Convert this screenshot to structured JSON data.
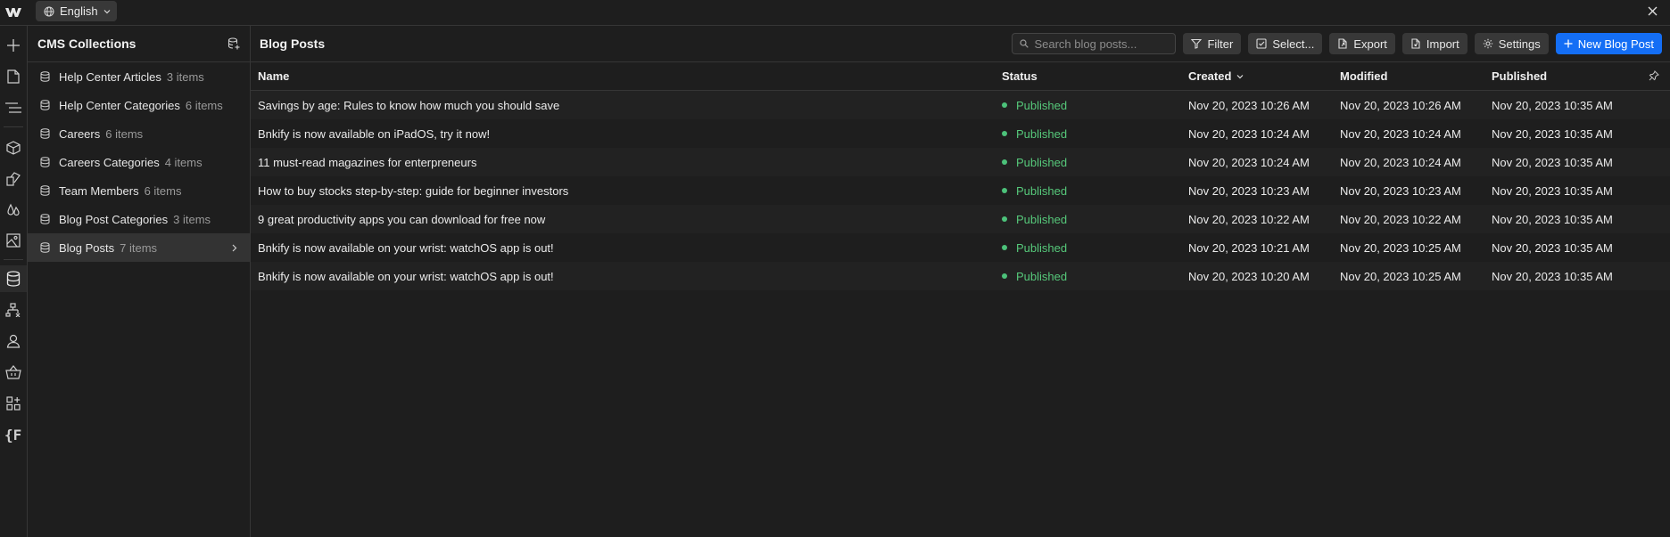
{
  "topbar": {
    "language": "English"
  },
  "collections": {
    "title": "CMS Collections",
    "items": [
      {
        "name": "Help Center Articles",
        "count": "3 items"
      },
      {
        "name": "Help Center Categories",
        "count": "6 items"
      },
      {
        "name": "Careers",
        "count": "6 items"
      },
      {
        "name": "Careers Categories",
        "count": "4 items"
      },
      {
        "name": "Team Members",
        "count": "6 items"
      },
      {
        "name": "Blog Post Categories",
        "count": "3 items"
      },
      {
        "name": "Blog Posts",
        "count": "7 items"
      }
    ]
  },
  "main": {
    "title": "Blog Posts",
    "search_placeholder": "Search blog posts...",
    "buttons": {
      "filter": "Filter",
      "select": "Select...",
      "export": "Export",
      "import": "Import",
      "settings": "Settings",
      "new": "New Blog Post"
    },
    "columns": {
      "name": "Name",
      "status": "Status",
      "created": "Created",
      "modified": "Modified",
      "published": "Published"
    },
    "rows": [
      {
        "name": "Savings by age: Rules to know how much you should save",
        "status": "Published",
        "created": "Nov 20, 2023 10:26 AM",
        "modified": "Nov 20, 2023 10:26 AM",
        "published": "Nov 20, 2023 10:35 AM"
      },
      {
        "name": "Bnkify is now available on iPadOS, try it now!",
        "status": "Published",
        "created": "Nov 20, 2023 10:24 AM",
        "modified": "Nov 20, 2023 10:24 AM",
        "published": "Nov 20, 2023 10:35 AM"
      },
      {
        "name": "11 must-read magazines for enterpreneurs",
        "status": "Published",
        "created": "Nov 20, 2023 10:24 AM",
        "modified": "Nov 20, 2023 10:24 AM",
        "published": "Nov 20, 2023 10:35 AM"
      },
      {
        "name": "How to buy stocks step-by-step: guide for beginner investors",
        "status": "Published",
        "created": "Nov 20, 2023 10:23 AM",
        "modified": "Nov 20, 2023 10:23 AM",
        "published": "Nov 20, 2023 10:35 AM"
      },
      {
        "name": "9 great productivity apps you can download for free now",
        "status": "Published",
        "created": "Nov 20, 2023 10:22 AM",
        "modified": "Nov 20, 2023 10:22 AM",
        "published": "Nov 20, 2023 10:35 AM"
      },
      {
        "name": "Bnkify is now available on your wrist: watchOS app is out!",
        "status": "Published",
        "created": "Nov 20, 2023 10:21 AM",
        "modified": "Nov 20, 2023 10:25 AM",
        "published": "Nov 20, 2023 10:35 AM"
      },
      {
        "name": "Bnkify is now available on your wrist: watchOS app is out!",
        "status": "Published",
        "created": "Nov 20, 2023 10:20 AM",
        "modified": "Nov 20, 2023 10:25 AM",
        "published": "Nov 20, 2023 10:35 AM"
      }
    ]
  },
  "colors": {
    "accent": "#146ef5",
    "status_published": "#4cc27a",
    "background": "#1e1e1e"
  }
}
